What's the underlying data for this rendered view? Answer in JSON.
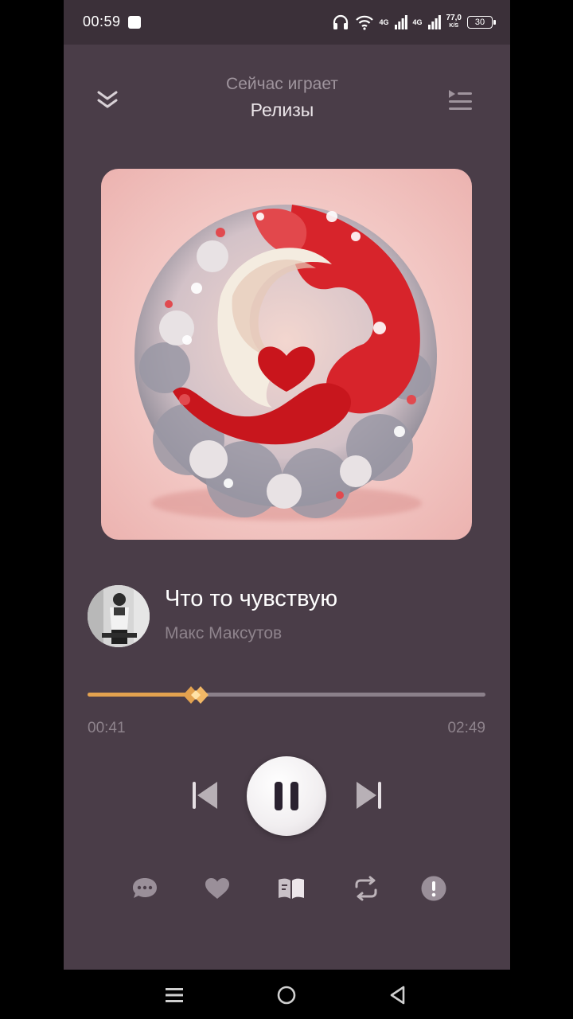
{
  "status_bar": {
    "time": "00:59",
    "network_1": "4G",
    "network_2": "4G",
    "speed_value": "77,0",
    "speed_unit": "K/S",
    "battery": "30"
  },
  "header": {
    "label": "Сейчас играет",
    "playlist": "Релизы",
    "collapse_icon": "chevron-double-down-icon",
    "queue_icon": "queue-list-icon"
  },
  "track": {
    "title": "Что то чувствую",
    "artist": "Макс Максутов"
  },
  "playback": {
    "elapsed": "00:41",
    "total": "02:49",
    "progress_fraction": 0.26,
    "state": "playing"
  },
  "actions": [
    {
      "icon": "comment-icon"
    },
    {
      "icon": "heart-icon"
    },
    {
      "icon": "lyrics-book-icon"
    },
    {
      "icon": "repeat-icon"
    },
    {
      "icon": "alert-icon"
    }
  ],
  "colors": {
    "background": "#4a3d48",
    "accent": "#e3a24f",
    "text_primary": "#ffffff",
    "text_secondary": "#8e838c"
  },
  "system_nav": {
    "items": [
      "menu-icon",
      "home-icon",
      "back-icon"
    ]
  }
}
